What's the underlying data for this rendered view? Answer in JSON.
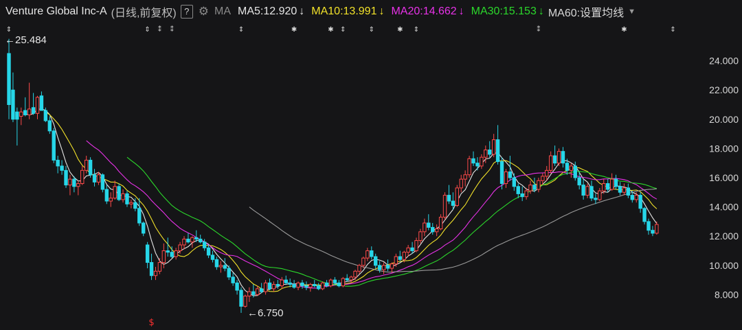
{
  "header": {
    "title": "Venture Global Inc-A",
    "adjust": "(日线,前复权)",
    "help": "?",
    "ma_label": "MA",
    "settings": "MA60:设置均线",
    "ma_items": [
      {
        "label": "MA5:12.920",
        "arrow": "↓",
        "color": "#e6e6e6"
      },
      {
        "label": "MA10:13.991",
        "arrow": "↓",
        "color": "#f2e22a"
      },
      {
        "label": "MA20:14.662",
        "arrow": "↓",
        "color": "#e832e8"
      },
      {
        "label": "MA30:15.153",
        "arrow": "↓",
        "color": "#2bd82b"
      }
    ]
  },
  "colors": {
    "up": "#ff4a4a",
    "down": "#27d6e8",
    "ma5": "#e6e6e6",
    "ma10": "#f2e22a",
    "ma20": "#e832e8",
    "ma30": "#2bd82b",
    "ma60": "#9a9a9a",
    "aux": "#3cc8e0"
  },
  "chart_data": {
    "type": "candlestick",
    "ylim": [
      6.5,
      26.0
    ],
    "yticks": [
      "24.000",
      "22.000",
      "20.000",
      "18.000",
      "16.000",
      "14.000",
      "12.000",
      "10.000",
      "8.000"
    ],
    "ytick_values": [
      24,
      22,
      20,
      18,
      16,
      14,
      12,
      10,
      8
    ],
    "annotations": {
      "high": {
        "text": "←25.484",
        "value": 25.484,
        "index": 0
      },
      "low": {
        "text": "←6.750",
        "value": 6.75,
        "index": 58
      }
    },
    "markers": [
      {
        "index": 0,
        "glyph": "⇕"
      },
      {
        "index": 34,
        "glyph": "⇕"
      },
      {
        "index": 37,
        "glyph": "⁑"
      },
      {
        "index": 40,
        "glyph": "⁑"
      },
      {
        "index": 57,
        "glyph": "⇕"
      },
      {
        "index": 70,
        "glyph": "✱"
      },
      {
        "index": 79,
        "glyph": "✱"
      },
      {
        "index": 82,
        "glyph": "⇕"
      },
      {
        "index": 89,
        "glyph": "⇕"
      },
      {
        "index": 96,
        "glyph": "✱"
      },
      {
        "index": 100,
        "glyph": "⇕"
      },
      {
        "index": 130,
        "glyph": "⁑"
      },
      {
        "index": 151,
        "glyph": "✱"
      },
      {
        "index": 163,
        "glyph": "⇕"
      }
    ],
    "dividend_marker": {
      "index": 35,
      "glyph": "$"
    },
    "ohlc": [
      [
        24.5,
        25.5,
        20.0,
        21.0
      ],
      [
        22.0,
        23.2,
        19.8,
        20.0
      ],
      [
        20.5,
        20.8,
        18.2,
        20.0
      ],
      [
        20.2,
        20.8,
        19.6,
        20.5
      ],
      [
        20.6,
        21.5,
        20.2,
        20.3
      ],
      [
        20.3,
        22.5,
        20.0,
        20.7
      ],
      [
        20.8,
        21.8,
        20.3,
        20.4
      ],
      [
        20.4,
        21.6,
        20.0,
        21.5
      ],
      [
        21.6,
        21.9,
        20.8,
        20.6
      ],
      [
        20.6,
        20.8,
        19.8,
        19.9
      ],
      [
        19.9,
        20.2,
        19.0,
        19.2
      ],
      [
        19.2,
        19.4,
        17.0,
        17.2
      ],
      [
        17.2,
        17.5,
        16.3,
        16.8
      ],
      [
        16.8,
        17.2,
        16.2,
        16.5
      ],
      [
        16.5,
        16.8,
        15.3,
        15.5
      ],
      [
        15.5,
        16.2,
        14.8,
        15.9
      ],
      [
        15.9,
        16.1,
        15.0,
        15.4
      ],
      [
        15.4,
        15.8,
        14.8,
        15.6
      ],
      [
        15.6,
        16.8,
        15.5,
        16.5
      ],
      [
        16.5,
        17.5,
        16.3,
        17.2
      ],
      [
        17.2,
        17.4,
        16.0,
        16.2
      ],
      [
        16.2,
        16.6,
        15.4,
        15.7
      ],
      [
        15.7,
        16.4,
        15.5,
        16.2
      ],
      [
        16.2,
        16.3,
        15.0,
        15.2
      ],
      [
        15.2,
        15.5,
        14.2,
        14.4
      ],
      [
        14.4,
        15.0,
        14.0,
        14.6
      ],
      [
        14.6,
        15.8,
        14.5,
        15.4
      ],
      [
        15.4,
        15.6,
        14.4,
        14.5
      ],
      [
        14.5,
        15.2,
        14.3,
        14.9
      ],
      [
        14.9,
        15.1,
        14.0,
        14.2
      ],
      [
        14.2,
        14.5,
        13.9,
        14.3
      ],
      [
        14.3,
        14.6,
        13.7,
        13.9
      ],
      [
        13.9,
        14.6,
        12.7,
        12.9
      ],
      [
        12.9,
        13.0,
        12.0,
        12.2
      ],
      [
        11.4,
        11.6,
        9.8,
        10.2
      ],
      [
        10.2,
        10.8,
        9.0,
        9.3
      ],
      [
        9.3,
        9.9,
        9.0,
        9.6
      ],
      [
        9.6,
        10.5,
        9.4,
        10.2
      ],
      [
        10.2,
        11.5,
        9.8,
        11.0
      ],
      [
        11.0,
        11.9,
        10.6,
        10.9
      ],
      [
        10.9,
        11.3,
        10.5,
        10.6
      ],
      [
        10.6,
        11.2,
        10.4,
        11.0
      ],
      [
        11.0,
        11.6,
        10.8,
        11.4
      ],
      [
        11.4,
        12.0,
        11.1,
        11.8
      ],
      [
        11.8,
        12.2,
        11.5,
        11.6
      ],
      [
        11.6,
        12.0,
        11.2,
        11.9
      ],
      [
        11.9,
        12.4,
        11.6,
        11.8
      ],
      [
        11.8,
        12.1,
        11.5,
        11.6
      ],
      [
        11.6,
        11.8,
        11.0,
        11.2
      ],
      [
        11.2,
        11.4,
        10.5,
        10.7
      ],
      [
        10.7,
        11.0,
        10.2,
        10.4
      ],
      [
        10.4,
        10.6,
        9.7,
        9.9
      ],
      [
        9.9,
        10.3,
        9.5,
        10.0
      ],
      [
        10.0,
        10.5,
        9.6,
        9.8
      ],
      [
        9.8,
        10.0,
        9.0,
        9.2
      ],
      [
        9.2,
        9.5,
        8.6,
        8.8
      ],
      [
        8.8,
        9.0,
        8.0,
        8.3
      ],
      [
        8.3,
        8.5,
        6.75,
        7.2
      ],
      [
        7.2,
        8.0,
        7.1,
        7.9
      ],
      [
        7.9,
        8.5,
        7.5,
        8.2
      ],
      [
        8.2,
        8.7,
        7.8,
        8.0
      ],
      [
        8.0,
        8.6,
        7.9,
        8.4
      ],
      [
        8.4,
        8.8,
        8.1,
        8.2
      ],
      [
        8.2,
        9.0,
        8.0,
        8.8
      ],
      [
        8.8,
        9.1,
        8.3,
        8.4
      ],
      [
        8.4,
        8.9,
        8.2,
        8.7
      ],
      [
        8.7,
        9.0,
        8.4,
        8.6
      ],
      [
        8.6,
        9.2,
        8.4,
        9.0
      ],
      [
        9.0,
        9.3,
        8.7,
        8.8
      ],
      [
        8.8,
        9.1,
        8.5,
        8.7
      ],
      [
        8.7,
        9.0,
        8.4,
        8.5
      ],
      [
        8.5,
        8.9,
        8.3,
        8.8
      ],
      [
        8.8,
        9.0,
        8.4,
        8.6
      ],
      [
        8.6,
        8.9,
        8.3,
        8.5
      ],
      [
        8.5,
        8.8,
        8.2,
        8.7
      ],
      [
        8.7,
        9.0,
        8.5,
        8.6
      ],
      [
        8.6,
        8.8,
        8.3,
        8.4
      ],
      [
        8.4,
        8.9,
        8.3,
        8.8
      ],
      [
        8.8,
        9.0,
        8.5,
        8.6
      ],
      [
        8.6,
        9.1,
        8.5,
        9.0
      ],
      [
        9.0,
        9.2,
        8.7,
        8.8
      ],
      [
        8.8,
        9.0,
        8.5,
        8.6
      ],
      [
        8.6,
        9.2,
        8.5,
        9.1
      ],
      [
        9.1,
        9.4,
        8.9,
        9.0
      ],
      [
        9.0,
        9.3,
        8.8,
        9.2
      ],
      [
        9.2,
        9.7,
        9.0,
        9.6
      ],
      [
        9.6,
        10.1,
        9.4,
        10.0
      ],
      [
        10.0,
        10.6,
        9.8,
        10.5
      ],
      [
        10.5,
        11.2,
        10.3,
        11.0
      ],
      [
        11.0,
        11.3,
        10.4,
        10.6
      ],
      [
        10.6,
        10.8,
        9.8,
        10.0
      ],
      [
        10.0,
        10.3,
        9.5,
        9.7
      ],
      [
        9.7,
        10.2,
        9.4,
        10.0
      ],
      [
        10.0,
        10.4,
        9.6,
        9.8
      ],
      [
        9.8,
        10.2,
        9.5,
        10.1
      ],
      [
        10.1,
        10.8,
        9.9,
        10.6
      ],
      [
        10.6,
        11.0,
        10.3,
        10.4
      ],
      [
        10.4,
        11.0,
        10.2,
        10.9
      ],
      [
        10.9,
        11.4,
        10.6,
        11.2
      ],
      [
        11.2,
        11.6,
        10.8,
        11.0
      ],
      [
        11.0,
        11.9,
        10.9,
        11.7
      ],
      [
        11.7,
        12.5,
        11.5,
        12.3
      ],
      [
        12.3,
        13.2,
        12.0,
        12.9
      ],
      [
        12.9,
        13.5,
        12.4,
        12.6
      ],
      [
        12.6,
        12.9,
        12.1,
        12.3
      ],
      [
        12.3,
        12.8,
        12.0,
        12.5
      ],
      [
        12.5,
        13.5,
        12.4,
        13.3
      ],
      [
        13.3,
        15.0,
        13.1,
        14.8
      ],
      [
        14.8,
        15.5,
        14.2,
        14.4
      ],
      [
        14.4,
        15.0,
        13.8,
        14.1
      ],
      [
        14.1,
        15.5,
        14.0,
        15.3
      ],
      [
        15.3,
        16.2,
        15.0,
        15.9
      ],
      [
        15.9,
        16.5,
        15.4,
        16.2
      ],
      [
        16.2,
        17.5,
        16.0,
        17.3
      ],
      [
        17.3,
        17.8,
        16.8,
        17.0
      ],
      [
        17.0,
        17.4,
        16.5,
        16.8
      ],
      [
        16.8,
        17.6,
        16.6,
        17.4
      ],
      [
        17.4,
        18.2,
        17.0,
        17.9
      ],
      [
        17.9,
        18.5,
        17.4,
        17.6
      ],
      [
        17.6,
        19.0,
        17.4,
        18.6
      ],
      [
        18.6,
        19.6,
        16.9,
        17.1
      ],
      [
        17.1,
        17.4,
        15.2,
        15.6
      ],
      [
        15.6,
        16.6,
        15.3,
        16.4
      ],
      [
        16.4,
        17.5,
        15.8,
        16.0
      ],
      [
        16.0,
        16.3,
        15.1,
        15.4
      ],
      [
        15.4,
        15.6,
        14.6,
        14.9
      ],
      [
        14.9,
        15.4,
        14.4,
        14.7
      ],
      [
        14.7,
        15.3,
        14.5,
        15.1
      ],
      [
        15.1,
        15.8,
        14.9,
        15.5
      ],
      [
        15.5,
        16.0,
        15.0,
        15.2
      ],
      [
        15.2,
        16.0,
        15.0,
        15.8
      ],
      [
        15.8,
        16.3,
        15.5,
        16.1
      ],
      [
        16.1,
        16.8,
        15.8,
        16.5
      ],
      [
        16.5,
        17.8,
        16.3,
        17.5
      ],
      [
        17.5,
        18.2,
        16.8,
        17.0
      ],
      [
        17.0,
        18.0,
        16.8,
        17.8
      ],
      [
        17.8,
        18.1,
        16.7,
        17.0
      ],
      [
        17.0,
        17.3,
        16.2,
        16.5
      ],
      [
        16.5,
        17.0,
        16.0,
        16.8
      ],
      [
        16.8,
        17.1,
        15.8,
        16.0
      ],
      [
        16.0,
        16.4,
        15.2,
        15.5
      ],
      [
        15.5,
        15.9,
        14.5,
        14.8
      ],
      [
        14.8,
        15.6,
        14.6,
        15.4
      ],
      [
        15.4,
        15.8,
        14.4,
        14.6
      ],
      [
        14.6,
        14.9,
        14.2,
        14.5
      ],
      [
        14.5,
        15.3,
        14.4,
        15.1
      ],
      [
        15.1,
        15.9,
        14.9,
        15.6
      ],
      [
        15.6,
        15.9,
        15.0,
        15.2
      ],
      [
        15.2,
        16.3,
        15.1,
        15.9
      ],
      [
        15.9,
        16.2,
        15.2,
        15.4
      ],
      [
        15.4,
        15.7,
        14.8,
        15.0
      ],
      [
        15.0,
        15.6,
        14.8,
        15.3
      ],
      [
        15.3,
        15.6,
        14.6,
        14.8
      ],
      [
        14.8,
        15.1,
        14.3,
        14.5
      ],
      [
        14.5,
        15.0,
        14.3,
        14.8
      ],
      [
        14.8,
        15.0,
        13.6,
        13.9
      ],
      [
        13.9,
        14.0,
        12.8,
        13.0
      ],
      [
        13.0,
        13.2,
        12.1,
        12.4
      ],
      [
        12.4,
        12.7,
        12.0,
        12.2
      ],
      [
        12.2,
        13.0,
        12.1,
        12.8
      ]
    ]
  }
}
